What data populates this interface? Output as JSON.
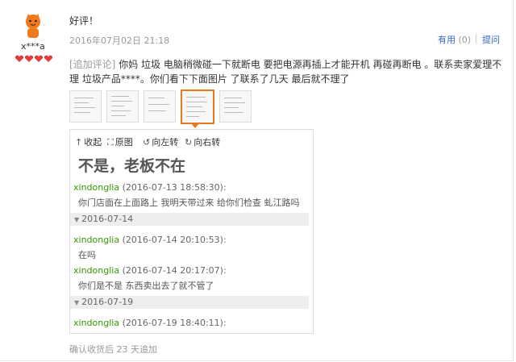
{
  "review": {
    "username": "x***a",
    "text": "好评！",
    "date": "2016年07月02日 21:18",
    "useful_label": "有用",
    "useful_count": "(0)",
    "ask_label": "提问"
  },
  "additional": {
    "tag": "[追加评论]",
    "text": " 你妈 垃圾 电脑稍微碰一下就断电 要把电源再插上才能开机 再碰再断电 。联系卖家爱理不理 垃圾产品****。你们看下下面图片 了联系了几天 最后就不理了"
  },
  "viewer": {
    "toolbar": {
      "collapse": "收起",
      "original": "原图",
      "rotate_left": "向左转",
      "rotate_right": "向右转"
    },
    "big_text": "不是，老板不在",
    "messages": [
      {
        "name": "xindonglia",
        "time": "(2016-07-13 18:58:30):",
        "body": "你门店面在上面路上 我明天带过来 给你们检查  虬江路吗"
      },
      {
        "date_header": "2016-07-14"
      },
      {
        "name": "xindonglia",
        "time": "(2016-07-14 20:10:53):",
        "body": "在吗"
      },
      {
        "name": "xindonglia",
        "time": "(2016-07-14 20:17:07):",
        "body": "你们是不是 东西卖出去了就不管了"
      },
      {
        "date_header": "2016-07-19"
      },
      {
        "name": "xindonglia",
        "time": "(2016-07-19 18:40:11):",
        "body": ""
      }
    ]
  },
  "footer": "确认收货后 23 天追加",
  "colors": {
    "link": "#3366cc",
    "accent": "#e4791f",
    "name_green": "#339900"
  }
}
